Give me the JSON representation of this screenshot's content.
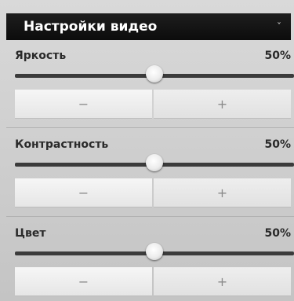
{
  "header": {
    "title": "Настройки видео",
    "collapse_icon": "chevron-down-icon",
    "collapse_glyph": "ˇ"
  },
  "settings": [
    {
      "label": "Яркость",
      "value_text": "50%",
      "value": 0.5,
      "minus_label": "−",
      "plus_label": "+"
    },
    {
      "label": "Контрастность",
      "value_text": "50%",
      "value": 0.5,
      "minus_label": "−",
      "plus_label": "+"
    },
    {
      "label": "Цвет",
      "value_text": "50%",
      "value": 0.5,
      "minus_label": "−",
      "plus_label": "+"
    }
  ],
  "colors": {
    "header_bg": "#111111",
    "track": "#3b3b3b",
    "panel": "#cfcfcf"
  }
}
